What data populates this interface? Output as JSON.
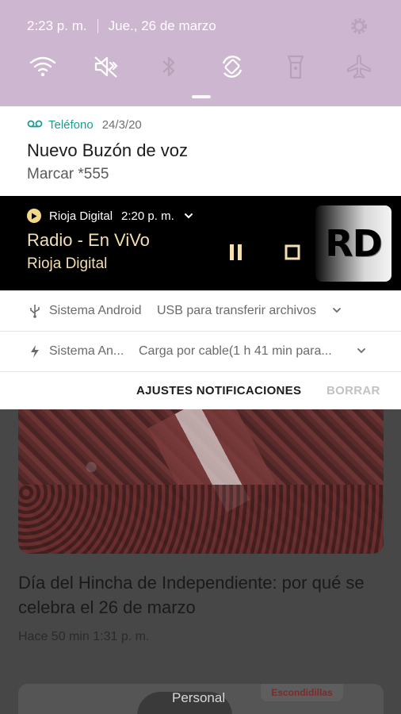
{
  "status_bar": {
    "time": "2:23 p. m.",
    "date": "Jue., 26 de marzo"
  },
  "quick_settings": {
    "background_color": "#cdb6cf",
    "toggles": [
      {
        "name": "wifi-icon",
        "active": true
      },
      {
        "name": "sound-mute-icon",
        "active": true
      },
      {
        "name": "bluetooth-icon",
        "active": false
      },
      {
        "name": "auto-rotate-icon",
        "active": true
      },
      {
        "name": "flashlight-icon",
        "active": false
      },
      {
        "name": "airplane-mode-icon",
        "active": false
      }
    ]
  },
  "notifications": {
    "voicemail": {
      "app": "Teléfono",
      "date": "24/3/20",
      "title": "Nuevo Buzón de voz",
      "text": "Marcar *555",
      "accent": "#1a9e8f"
    },
    "media": {
      "app": "Rioja Digital",
      "time": "2:20 p. m.",
      "title": "Radio - En ViVo",
      "artist": "Rioja Digital",
      "art_text": "RD",
      "text_color": "#f3dfb0"
    },
    "system_usb": {
      "app": "Sistema Android",
      "text": "USB para transferir archivos"
    },
    "system_charge": {
      "app": "Sistema An...",
      "text": "Carga por cable(1 h 41 min para..."
    },
    "actions": {
      "settings_label": "AJUSTES NOTIFICACIONES",
      "clear_label": "BORRAR"
    }
  },
  "background_app": {
    "headline": "Día del Hincha de Independiente: por qué se celebra el 26 de marzo",
    "timestamp": "Hace 50 min 1:31 p. m.",
    "tag": "Escondidillas",
    "toast": "Personal"
  }
}
